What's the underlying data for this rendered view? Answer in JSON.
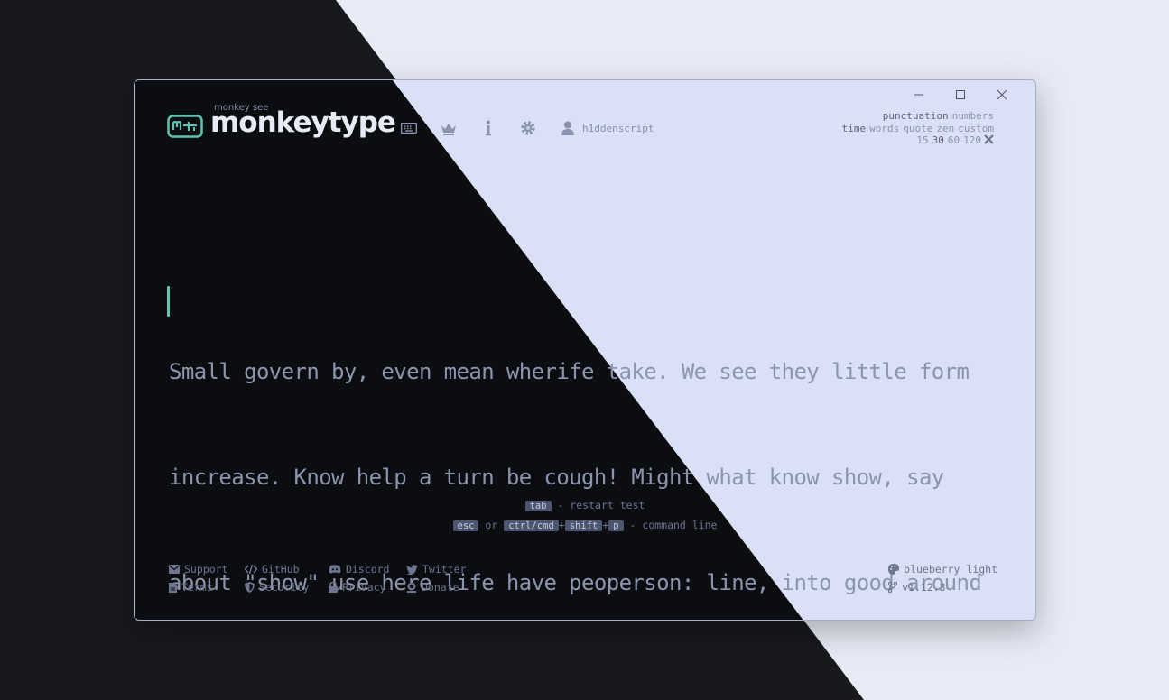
{
  "window": {
    "controls": [
      "minimize",
      "maximize",
      "close"
    ]
  },
  "logo": {
    "sub": "monkey see",
    "title": "monkeytype"
  },
  "nav": {
    "icons": [
      "keyboard-icon",
      "crown-icon",
      "info-icon",
      "gear-icon"
    ],
    "user": "h1ddenscript"
  },
  "config": {
    "row1": [
      {
        "label": "punctuation",
        "active": true
      },
      {
        "label": "numbers",
        "active": false
      }
    ],
    "row2": [
      {
        "label": "time",
        "active": true
      },
      {
        "label": "words",
        "active": false
      },
      {
        "label": "quote",
        "active": false
      },
      {
        "label": "zen",
        "active": false
      },
      {
        "label": "custom",
        "active": false
      }
    ],
    "row3": [
      {
        "label": "15",
        "active": false
      },
      {
        "label": "30",
        "active": true
      },
      {
        "label": "60",
        "active": false
      },
      {
        "label": "120",
        "active": false
      }
    ]
  },
  "test": {
    "lines": [
      "Small govern by, even mean wherife take. We see they little form",
      "increase. Know help a turn be cough! Might what know show, say",
      "about \"show\" use here life have peoperson: line, into good around"
    ]
  },
  "hints": {
    "restart_key": "tab",
    "restart_text": "- restart test",
    "cmd_key1": "esc",
    "cmd_or": "or",
    "cmd_key2": "ctrl/cmd",
    "cmd_plus": "+",
    "cmd_key3": "shift",
    "cmd_key4": "p",
    "cmd_text": "- command line"
  },
  "footer": {
    "support": "Support",
    "github": "GitHub",
    "discord": "Discord",
    "twitter": "Twitter",
    "terms": "Terms",
    "security": "Security",
    "privacy": "Privacy",
    "donate": "Donate",
    "theme": "blueberry light",
    "version": "v1.12.3"
  },
  "colors": {
    "accent": "#5ec3b4",
    "dark_bg": "#0c0d10",
    "light_bg": "#dae0f5",
    "sub_text": "#8b95ae"
  }
}
